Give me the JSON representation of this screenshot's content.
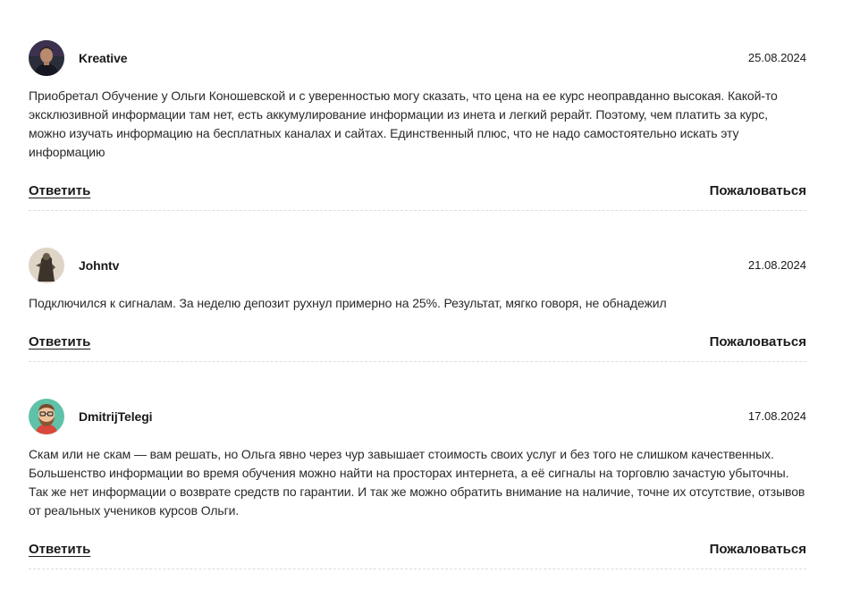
{
  "comments": [
    {
      "author": "Kreative",
      "date": "25.08.2024",
      "text": "Приобретал Обучение у Ольги Коношевской и с уверенностью могу сказать, что цена на ее курс неоправданно высокая. Какой-то эксклюзивной информации там нет, есть аккумулирование информации из инета и легкий рерайт. Поэтому, чем платить за курс, можно изучать информацию на бесплатных каналах и сайтах. Единственный плюс, что не надо самостоятельно искать эту информацию",
      "reply_label": "Ответить",
      "report_label": "Пожаловаться",
      "avatar": "avatar-photo-man"
    },
    {
      "author": "Johntv",
      "date": "21.08.2024",
      "text": "Подключился к сигналам. За неделю депозит рухнул примерно на 25%. Результат, мягко говоря, не обнадежил",
      "reply_label": "Ответить",
      "report_label": "Пожаловаться",
      "avatar": "avatar-photo-figure"
    },
    {
      "author": "DmitrijTelegi",
      "date": "17.08.2024",
      "text": "Скам или не скам — вам решать, но Ольга явно через чур завышает стоимость своих услуг и без того не слишком качественных. Большенство информации во время обучения можно найти на просторах интернета, а её сигналы на торговлю зачастую убыточны. Так же нет информации о возврате средств по гарантии. И так же можно обратить внимание на наличие, точне их отсутствие, отзывов от реальных учеников курсов Ольги.",
      "reply_label": "Ответить",
      "report_label": "Пожаловаться",
      "avatar": "avatar-cartoon-bearded"
    }
  ],
  "colors": {
    "text": "#1a1a1a",
    "divider": "#dcdcdc",
    "avatar_teal": "#5ec1a8"
  }
}
